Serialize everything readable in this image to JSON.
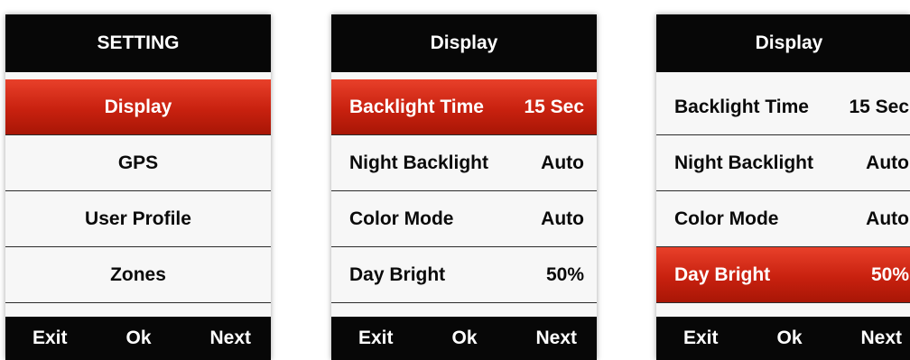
{
  "screens": [
    {
      "title": "SETTING",
      "items": [
        {
          "label": "Display",
          "value": ""
        },
        {
          "label": "GPS",
          "value": ""
        },
        {
          "label": "User Profile",
          "value": ""
        },
        {
          "label": "Zones",
          "value": ""
        }
      ],
      "selected_index": 0,
      "footer": {
        "exit": "Exit",
        "ok": "Ok",
        "next": "Next"
      }
    },
    {
      "title": "Display",
      "items": [
        {
          "label": "Backlight Time",
          "value": "15 Sec"
        },
        {
          "label": "Night Backlight",
          "value": "Auto"
        },
        {
          "label": "Color Mode",
          "value": "Auto"
        },
        {
          "label": "Day Bright",
          "value": "50%"
        }
      ],
      "selected_index": 0,
      "footer": {
        "exit": "Exit",
        "ok": "Ok",
        "next": "Next"
      }
    },
    {
      "title": "Display",
      "items": [
        {
          "label": "Backlight Time",
          "value": "15 Sec"
        },
        {
          "label": "Night Backlight",
          "value": "Auto"
        },
        {
          "label": "Color Mode",
          "value": "Auto"
        },
        {
          "label": "Day Bright",
          "value": "50%"
        }
      ],
      "selected_index": 3,
      "footer": {
        "exit": "Exit",
        "ok": "Ok",
        "next": "Next"
      }
    }
  ],
  "colors": {
    "selected_gradient_top": "#e8402a",
    "selected_gradient_bottom": "#a81606",
    "header_bg": "#070707",
    "item_bg": "#f7f7f7"
  }
}
